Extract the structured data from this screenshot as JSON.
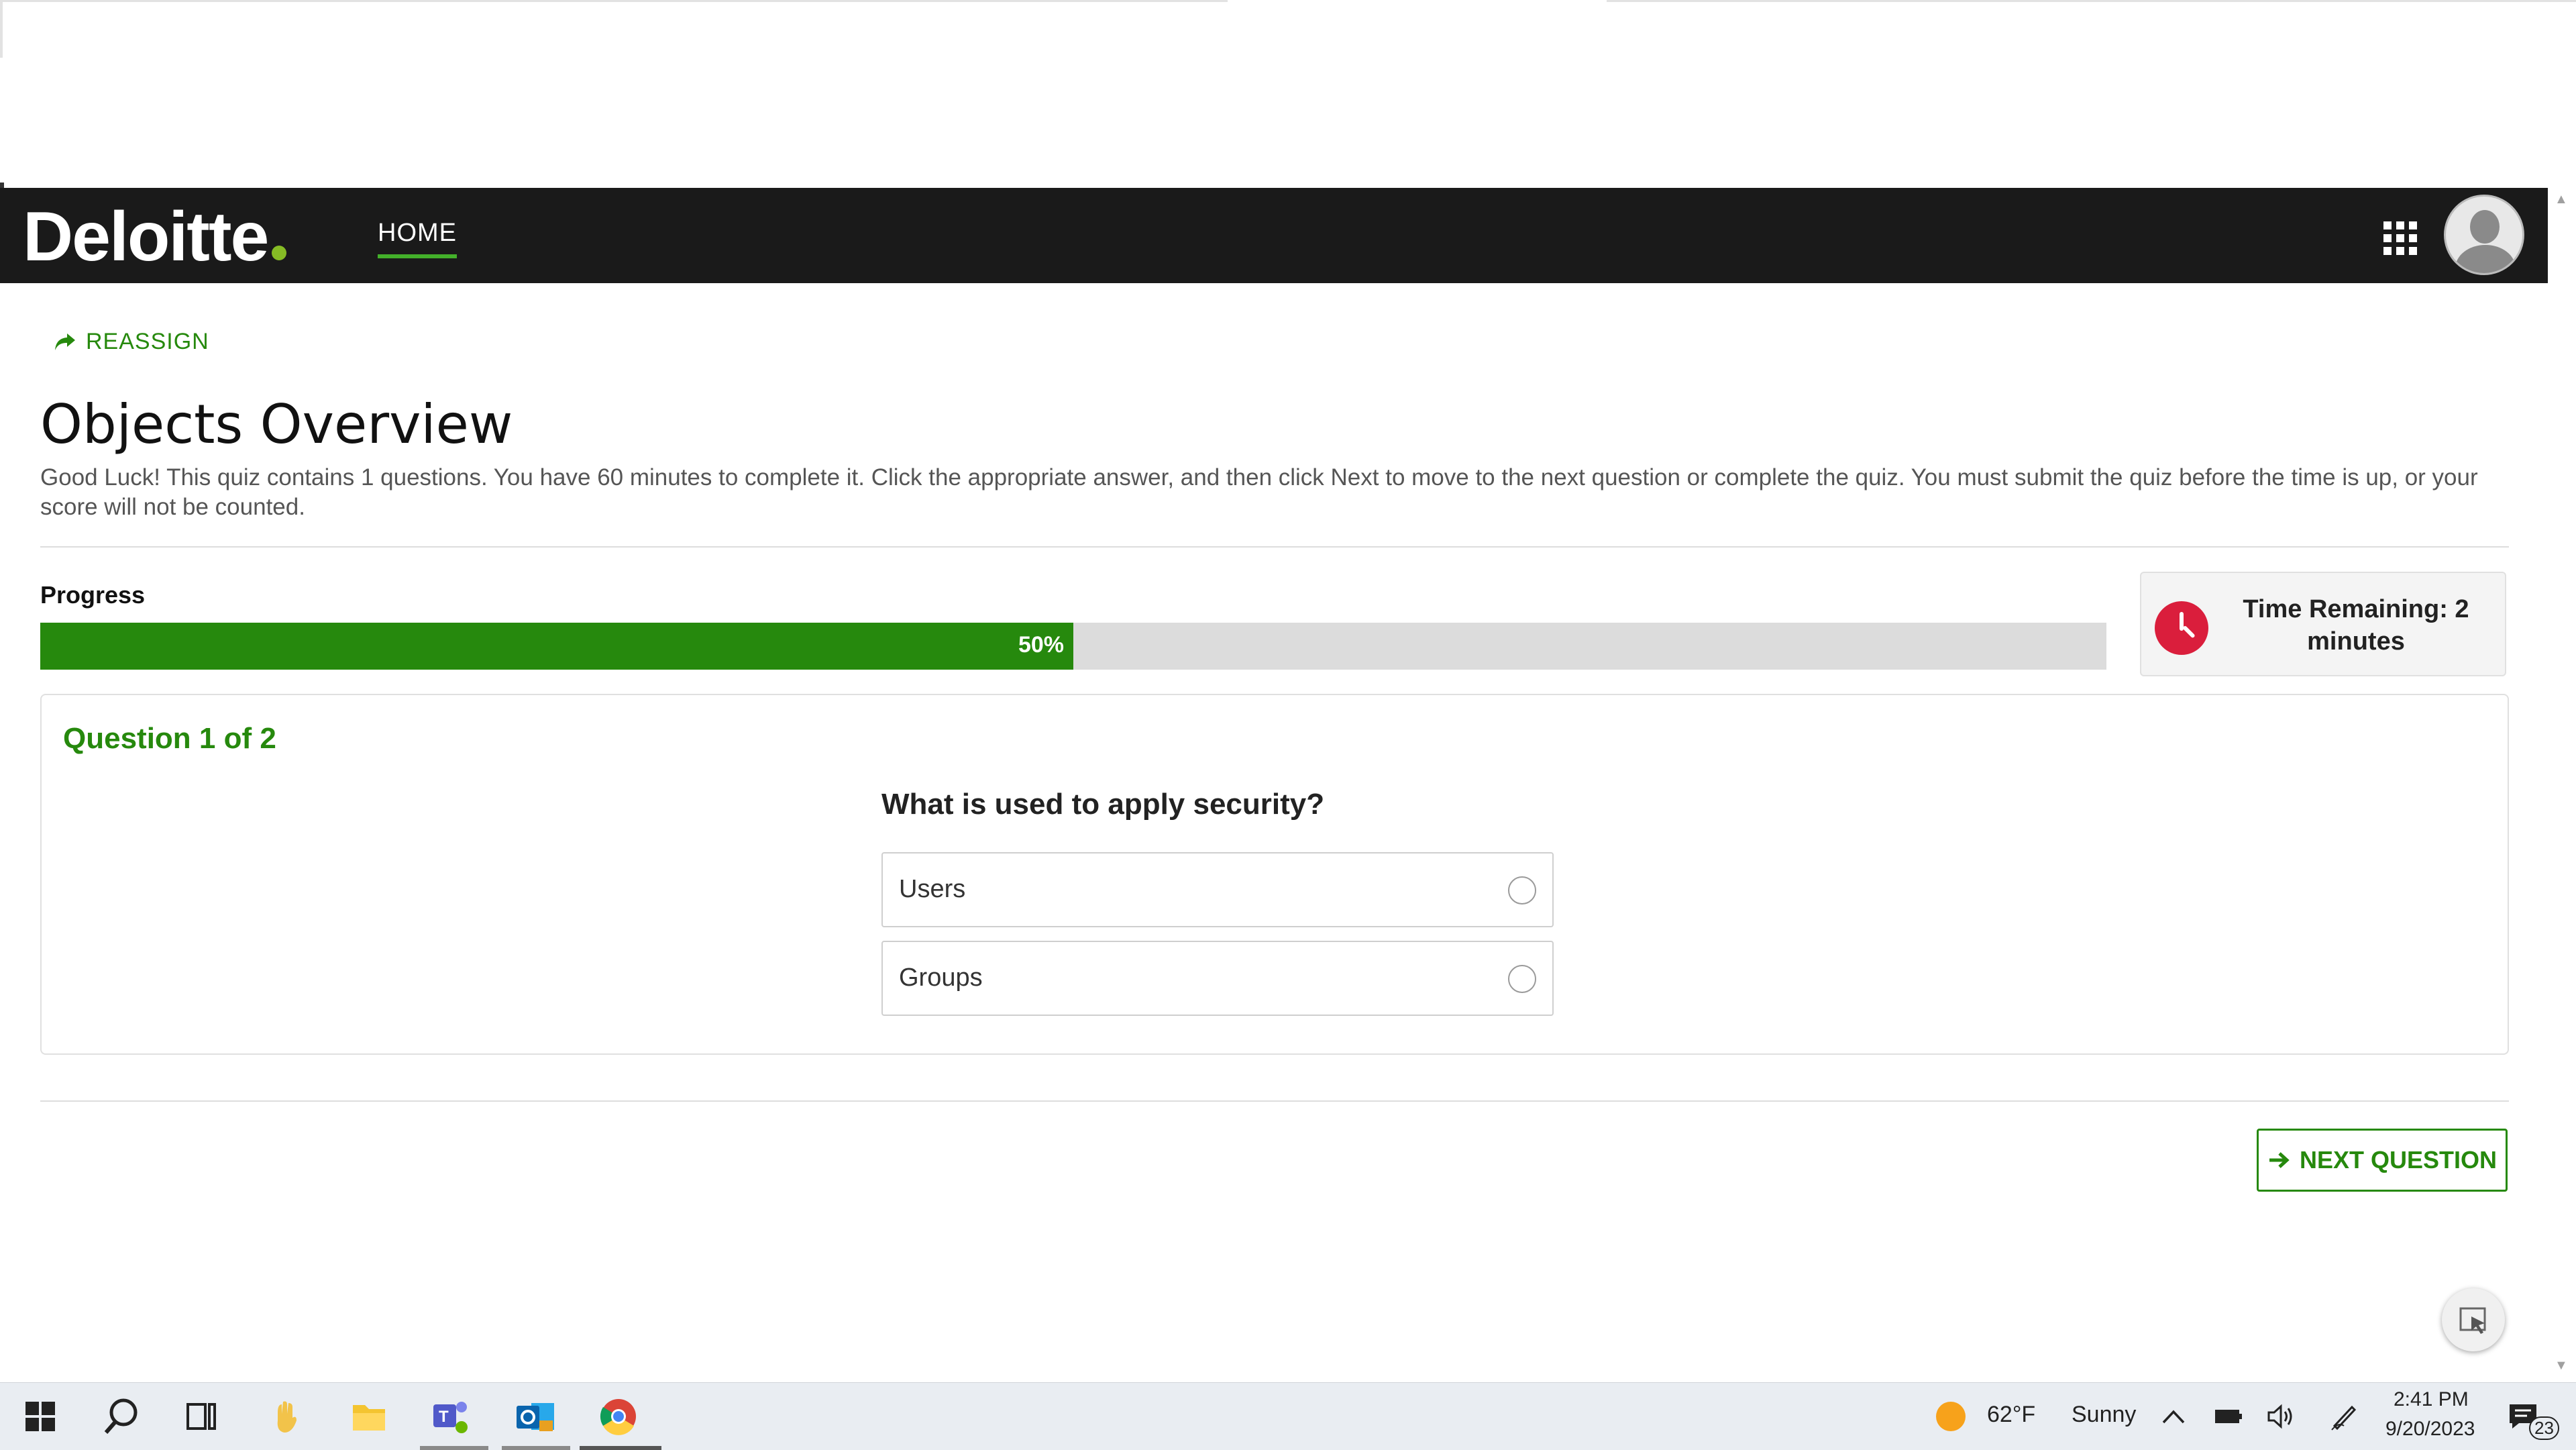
{
  "header": {
    "logo_text": "Deloitte",
    "nav_home": "HOME",
    "brand_color": "#86bc25"
  },
  "actions": {
    "reassign": "REASSIGN"
  },
  "page": {
    "title": "Objects Overview",
    "intro": "Good Luck! This quiz contains 1 questions. You have 60 minutes to complete it. Click the appropriate answer, and then click Next to move to the next question or complete the quiz. You must submit the quiz before the time is up, or your score will not be counted."
  },
  "progress": {
    "label": "Progress",
    "value": 50,
    "text": "50%",
    "fill_color": "#26890d"
  },
  "timer": {
    "text": "Time Remaining: 2 minutes",
    "icon_color": "#da1e3c"
  },
  "question": {
    "counter": "Question 1 of 2",
    "text": "What is used to apply security?",
    "options": [
      {
        "label": "Users"
      },
      {
        "label": "Groups"
      }
    ]
  },
  "footer": {
    "next_button": "NEXT QUESTION"
  },
  "taskbar": {
    "weather_temp": "62°F",
    "weather_desc": "Sunny",
    "time": "2:41 PM",
    "date": "9/20/2023",
    "notification_count": "23"
  }
}
